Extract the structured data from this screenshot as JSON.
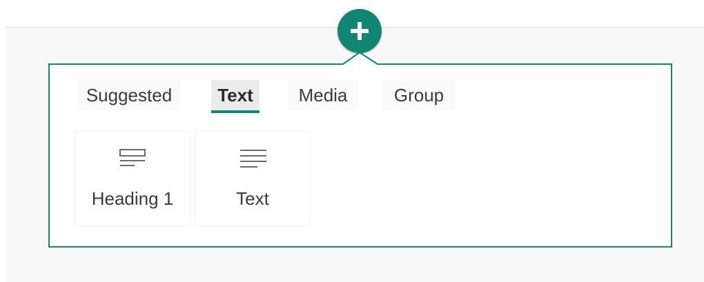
{
  "add_button": {
    "icon": "plus-icon",
    "color": "#138575"
  },
  "toolbox": {
    "accent_color": "#138575",
    "tabs": [
      {
        "label": "Suggested",
        "selected": false
      },
      {
        "label": "Text",
        "selected": true
      },
      {
        "label": "Media",
        "selected": false
      },
      {
        "label": "Group",
        "selected": false
      }
    ],
    "items": [
      {
        "label": "Heading 1",
        "icon": "heading-icon"
      },
      {
        "label": "Text",
        "icon": "text-lines-icon"
      }
    ]
  }
}
